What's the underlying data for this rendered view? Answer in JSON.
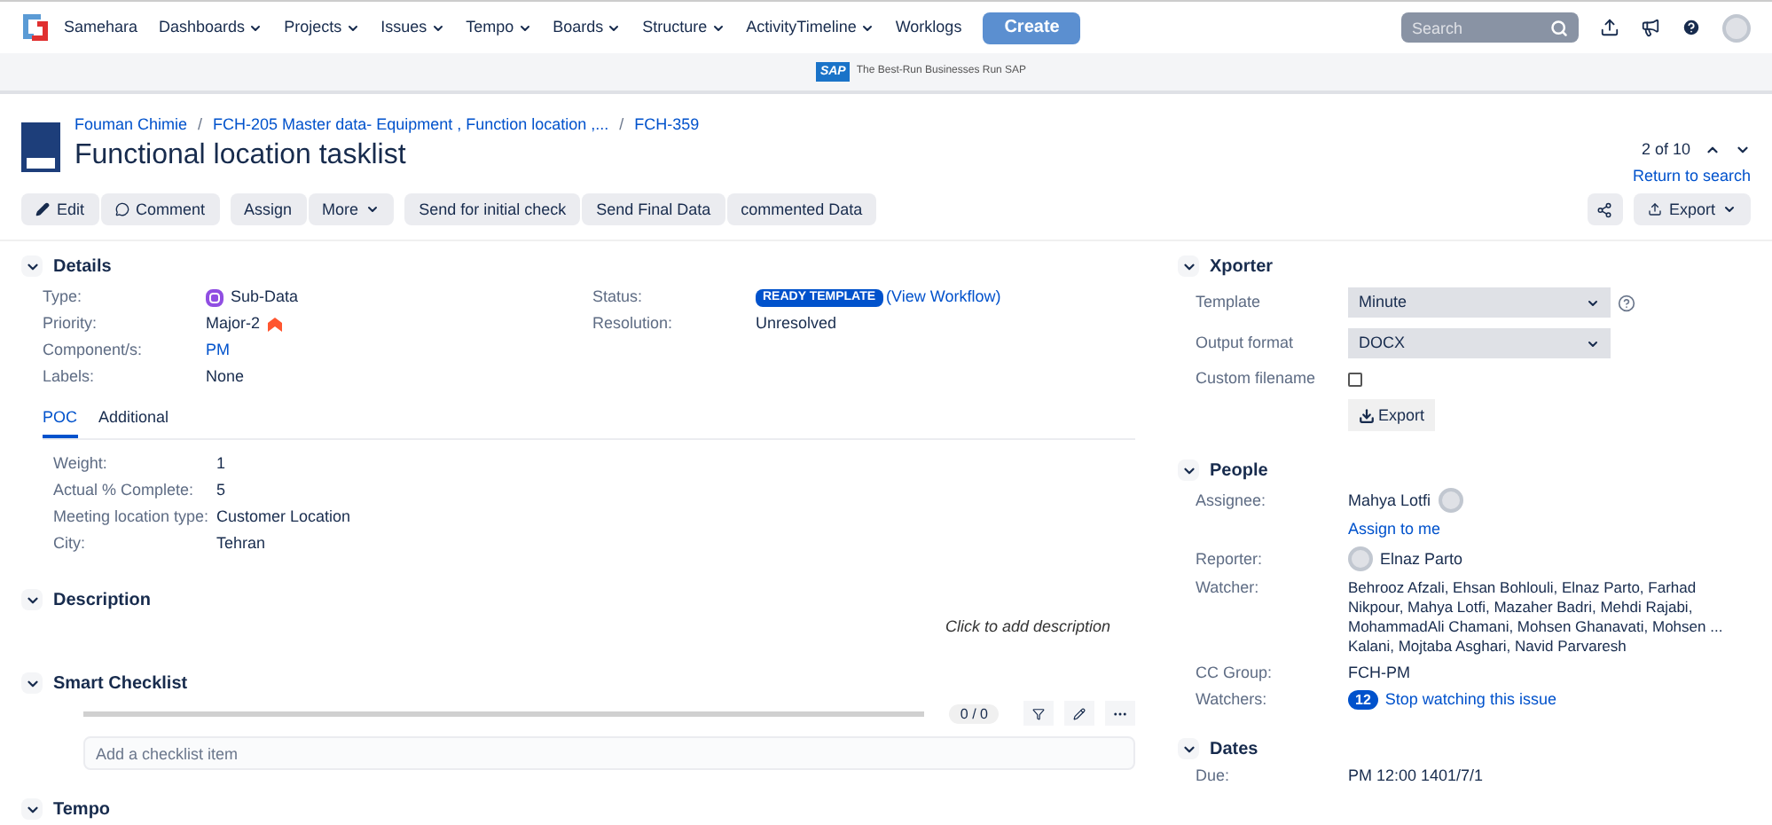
{
  "nav": {
    "brand": "Samehara",
    "menus": [
      {
        "label": "Dashboards",
        "dropdown": true
      },
      {
        "label": "Projects",
        "dropdown": true
      },
      {
        "label": "Issues",
        "dropdown": true
      },
      {
        "label": "Tempo",
        "dropdown": true
      },
      {
        "label": "Boards",
        "dropdown": true
      },
      {
        "label": "Structure",
        "dropdown": true
      },
      {
        "label": "ActivityTimeline",
        "dropdown": true
      },
      {
        "label": "Worklogs",
        "dropdown": false
      }
    ],
    "create": "Create",
    "search": {
      "placeholder": "Search"
    }
  },
  "banner": {
    "logo": "SAP",
    "tagline": "The Best-Run Businesses Run SAP"
  },
  "breadcrumbs": [
    {
      "label": "Fouman Chimie",
      "separator": "/"
    },
    {
      "label": "FCH-205 Master data- Equipment , Function location ,...",
      "separator": "/"
    },
    {
      "label": "FCH-359"
    }
  ],
  "title": "Functional location tasklist",
  "pager": {
    "text": "2 of 10",
    "return": "Return to search"
  },
  "toolbar": [
    {
      "label": "Edit",
      "dropdown": false
    },
    {
      "label": "Comment",
      "dropdown": false
    },
    {
      "label": "Assign",
      "dropdown": false
    },
    {
      "label": "More",
      "dropdown": true
    },
    {
      "label": "Send for initial check",
      "dropdown": false
    },
    {
      "label": "Send Final Data",
      "dropdown": false
    },
    {
      "label": "commented Data",
      "dropdown": false
    }
  ],
  "export_button": "Export",
  "details": {
    "heading": "Details",
    "left": [
      {
        "label": "Type:",
        "value": "Sub-Data",
        "kind": "type"
      },
      {
        "label": "Priority:",
        "value": "Major-2",
        "kind": "priority"
      },
      {
        "label": "Component/s:",
        "value": "PM",
        "kind": "link"
      },
      {
        "label": "Labels:",
        "value": "None",
        "kind": "text"
      }
    ],
    "right": [
      {
        "label": "Status:",
        "value": "READY TEMPLATE",
        "link": "(View Workflow)",
        "kind": "status"
      },
      {
        "label": "Resolution:",
        "value": "Unresolved",
        "kind": "text"
      }
    ],
    "tabs": [
      {
        "label": "POC",
        "selected": true
      },
      {
        "label": "Additional",
        "selected": false
      }
    ],
    "fields": [
      {
        "label": "Weight:",
        "value": "1"
      },
      {
        "label": "Actual % Complete:",
        "value": "5"
      },
      {
        "label": "Meeting location type:",
        "value": "Customer Location"
      },
      {
        "label": "City:",
        "value": "Tehran"
      }
    ]
  },
  "description": {
    "heading": "Description",
    "placeholder": "Click to add description"
  },
  "checklist": {
    "heading": "Smart Checklist",
    "level": 0,
    "count": "0 / 0",
    "placeholder": "Add a checklist item"
  },
  "tempo": {
    "heading": "Tempo"
  },
  "xporter": {
    "heading": "Xporter",
    "template_label": "Template",
    "template": "Minute",
    "format_label": "Output format",
    "format": "DOCX",
    "filename_label": "Custom filename",
    "filename_checked": false,
    "button": "Export"
  },
  "people": {
    "heading": "People",
    "assignee_label": "Assignee:",
    "assignee": "Mahya Lotfi",
    "assign_to_me": "Assign to me",
    "reporter_label": "Reporter:",
    "reporter": "Elnaz Parto",
    "watcher_label": "Watcher:",
    "watcher": "Behrooz Afzali, Ehsan Bohlouli, Elnaz Parto, Farhad Nikpour, Mahya Lotfi, Mazaher Badri, Mehdi Rajabi, MohammadAli Chamani, Mohsen Ghanavati, Mohsen ... Kalani, Mojtaba Asghari, Navid Parvaresh",
    "cc_label": "CC Group:",
    "cc": "FCH-PM",
    "watchers_label": "Watchers:",
    "watchers_count": "12",
    "watch_link": "Stop watching this issue"
  },
  "dates": {
    "heading": "Dates",
    "due_label": "Due:",
    "due": "PM 12:00 1401/7/1"
  }
}
